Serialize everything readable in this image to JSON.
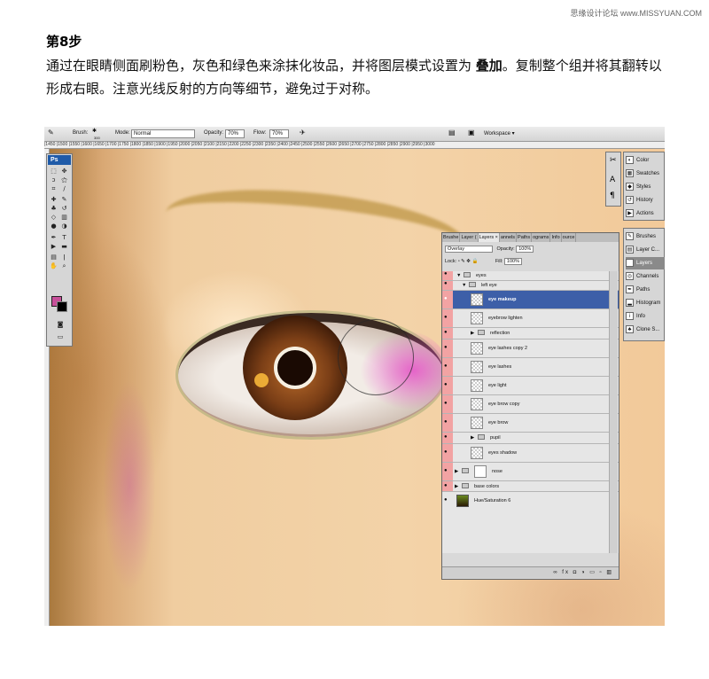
{
  "watermark": "思缘设计论坛 www.MISSYUAN.COM",
  "step": {
    "title": "第8步",
    "desc_part1": "通过在眼睛侧面刷粉色，灰色和绿色来涂抹化妆品，并将图层模式设置为 ",
    "desc_bold": "叠加",
    "desc_part2": "。复制整个组并将其翻转以形成右眼。注意光线反射的方向等细节，避免过于对称。"
  },
  "options_bar": {
    "brush_label": "Brush:",
    "brush_size": "300",
    "mode_label": "Mode:",
    "mode_value": "Normal",
    "opacity_label": "Opacity:",
    "opacity_value": "70%",
    "flow_label": "Flow:",
    "flow_value": "70%",
    "workspace_label": "Workspace ▾"
  },
  "ruler_ticks": "|1450 |1500 |1550 |1600 |1650 |1700 |1750 |1800 |1850 |1900 |1950 |2000 |2050 |2100 |2150 |2200 |2250 |2300 |2350 |2400 |2450 |2500 |2550 |2600 |2650 |2700 |2750 |2800 |2850 |2900 |2950 |3000",
  "tools_panel": {
    "title": "Ps"
  },
  "dock": {
    "group1": [
      {
        "label": "Color",
        "icon": "color-icon"
      },
      {
        "label": "Swatches",
        "icon": "swatches-icon"
      },
      {
        "label": "Styles",
        "icon": "styles-icon"
      },
      {
        "label": "History",
        "icon": "history-icon"
      },
      {
        "label": "Actions",
        "icon": "actions-icon"
      }
    ],
    "group2": [
      {
        "label": "Brushes",
        "icon": "brushes-icon"
      },
      {
        "label": "Layer C...",
        "icon": "layer-comps-icon"
      },
      {
        "label": "Layers",
        "icon": "layers-icon",
        "selected": true
      },
      {
        "label": "Channels",
        "icon": "channels-icon"
      },
      {
        "label": "Paths",
        "icon": "paths-icon"
      },
      {
        "label": "Histogram",
        "icon": "histogram-icon"
      },
      {
        "label": "Info",
        "icon": "info-icon"
      },
      {
        "label": "Clone S...",
        "icon": "clone-source-icon"
      }
    ]
  },
  "layers_panel": {
    "tabs": [
      "Brushe",
      "Layer (",
      "Layers ×",
      "annels",
      "Paths",
      "ograms",
      "Info",
      "ource"
    ],
    "blend_mode": "Overlay",
    "opacity_label": "Opacity:",
    "opacity_value": "100%",
    "lock_label": "Lock:",
    "fill_label": "Fill:",
    "fill_value": "100%",
    "layers": [
      {
        "name": "eyes",
        "kind": "group"
      },
      {
        "name": "left eye",
        "kind": "group"
      },
      {
        "name": "eye makeup",
        "kind": "layer",
        "selected": true
      },
      {
        "name": "eyebrow lighten",
        "kind": "layer"
      },
      {
        "name": "reflection",
        "kind": "group"
      },
      {
        "name": "eye lashes copy 2",
        "kind": "layer"
      },
      {
        "name": "eye lashes",
        "kind": "layer"
      },
      {
        "name": "eye light",
        "kind": "layer"
      },
      {
        "name": "eye brow copy",
        "kind": "layer"
      },
      {
        "name": "eye brow",
        "kind": "layer"
      },
      {
        "name": "pupil",
        "kind": "group"
      },
      {
        "name": "eyes shadow",
        "kind": "layer"
      },
      {
        "name": "nose",
        "kind": "group"
      },
      {
        "name": "base colors",
        "kind": "group"
      },
      {
        "name": "Hue/Saturation 6",
        "kind": "adjustment"
      }
    ],
    "footer_icons": "∞ fx ◘ ◑ ▭ ▫ ▥"
  },
  "colors": {
    "foreground": "#c84f9a",
    "background": "#000000",
    "selection": "#3d5fa8"
  }
}
